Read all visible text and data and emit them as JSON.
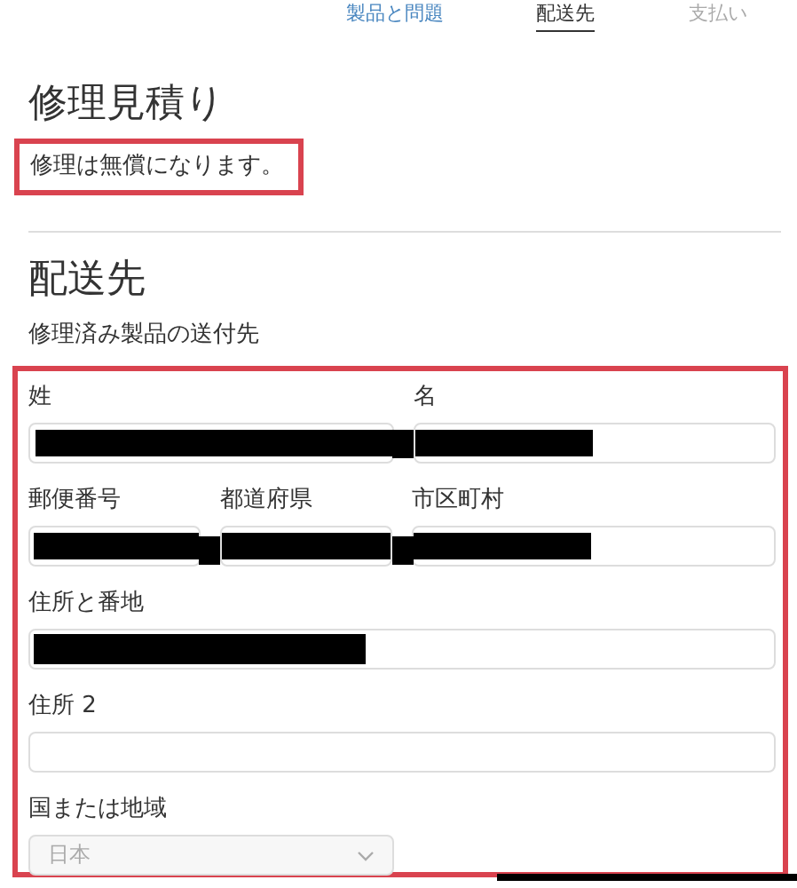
{
  "tabs": [
    {
      "label": "製品と問題",
      "completed": true,
      "selected": false
    },
    {
      "label": "配送先",
      "completed": false,
      "selected": true
    },
    {
      "label": "支払い",
      "completed": false,
      "selected": false
    }
  ],
  "estimate": {
    "title": "修理見積り",
    "note": "修理は無償になります。"
  },
  "shipping": {
    "title": "配送先",
    "subtitle": "修理済み製品の送付先",
    "field_groups": [
      [
        {
          "label": "姓",
          "kind": "text"
        },
        {
          "label": "名",
          "kind": "text"
        }
      ],
      [
        {
          "label": "郵便番号",
          "kind": "text"
        },
        {
          "label": "都道府県",
          "kind": "text"
        },
        {
          "label": "市区町村",
          "kind": "text"
        }
      ],
      [
        {
          "label": "住所と番地",
          "kind": "text"
        }
      ],
      [
        {
          "label": "住所 2",
          "kind": "text"
        }
      ],
      [
        {
          "label": "国または地域",
          "kind": "select",
          "value": "日本",
          "disabled": true
        }
      ]
    ]
  }
}
